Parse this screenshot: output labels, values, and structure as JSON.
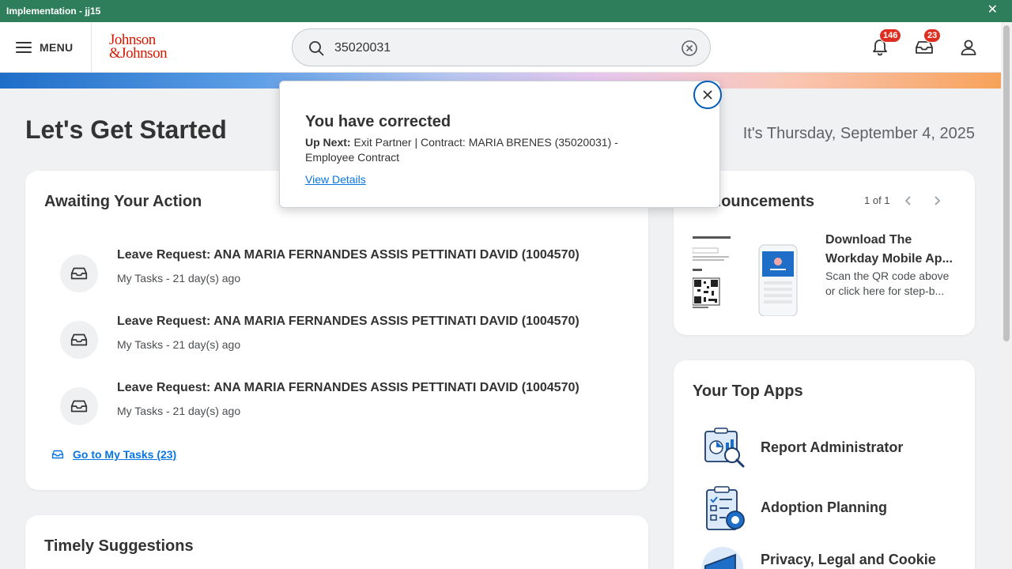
{
  "window": {
    "title": "Implementation - jj15",
    "close_glyph": "✕"
  },
  "header": {
    "menu_label": "MENU",
    "logo_line1": "Johnson",
    "logo_line2": "&Johnson",
    "search_value": "35020031",
    "notifications_count": "146",
    "inbox_count": "23"
  },
  "main": {
    "page_title": "Let's Get Started",
    "date": "It's Thursday, September 4, 2025"
  },
  "awaiting": {
    "title": "Awaiting Your Action",
    "tasks": [
      {
        "title": "Leave Request: ANA MARIA FERNANDES ASSIS PETTINATI DAVID (1004570)",
        "meta": "My Tasks - 21 day(s) ago"
      },
      {
        "title": "Leave Request: ANA MARIA FERNANDES ASSIS PETTINATI DAVID (1004570)",
        "meta": "My Tasks - 21 day(s) ago"
      },
      {
        "title": "Leave Request: ANA MARIA FERNANDES ASSIS PETTINATI DAVID (1004570)",
        "meta": "My Tasks - 21 day(s) ago"
      }
    ],
    "goto_label": "Go to My Tasks (23)"
  },
  "timely": {
    "title": "Timely Suggestions"
  },
  "announcements": {
    "title": "nouncements",
    "pager": "1 of 1",
    "item_title": "Download The Workday Mobile Ap...",
    "item_desc": "Scan the QR code above or click here for step-b..."
  },
  "top_apps": {
    "title": "Your Top Apps",
    "apps": [
      {
        "label": "Report Administrator",
        "icon": "report-admin-icon"
      },
      {
        "label": "Adoption Planning",
        "icon": "adoption-planning-icon"
      },
      {
        "label": "Privacy, Legal and Cookie",
        "icon": "privacy-legal-icon"
      }
    ]
  },
  "toast": {
    "title": "You have corrected",
    "up_next_label": "Up Next:",
    "up_next_text": "Exit Partner | Contract: MARIA BRENES (35020031) - Employee Contract",
    "link": "View Details"
  },
  "colors": {
    "titlebar": "#2e7d5b",
    "accent": "#0875e1",
    "badge": "#de2e21",
    "brand": "#d51900"
  }
}
